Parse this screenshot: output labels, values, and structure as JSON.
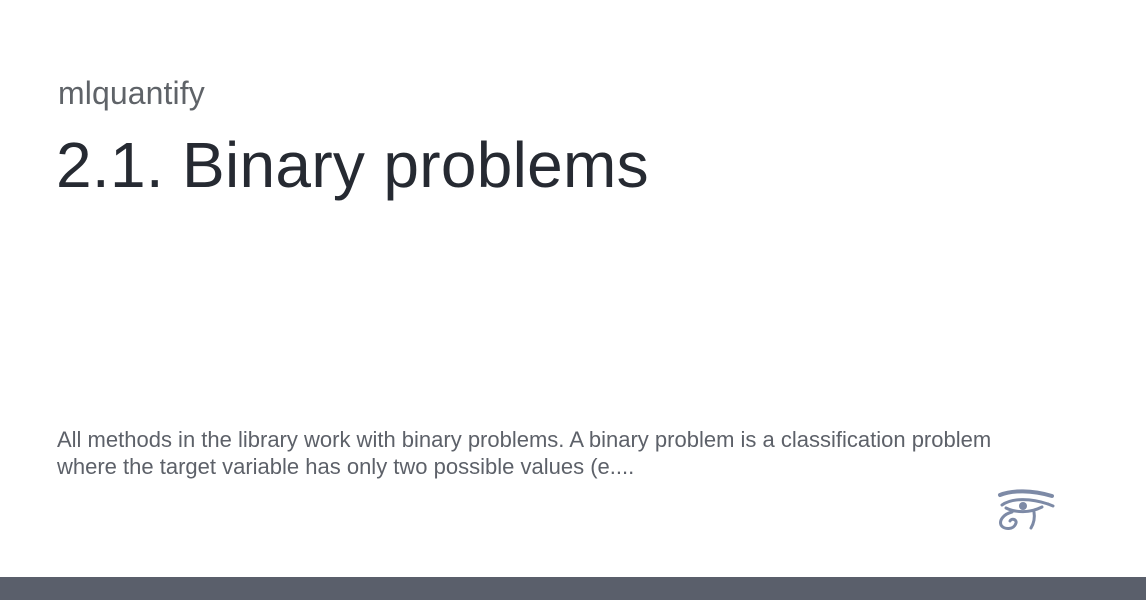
{
  "card": {
    "site_name": "mlquantify",
    "title": "2.1. Binary problems",
    "description": "All methods in the library work with binary problems. A binary problem is a classification problem where the target variable has only two possible values (e...."
  },
  "logo": {
    "icon": "eye-of-horus-icon",
    "color": "#7d8aa6"
  },
  "colors": {
    "background": "#ffffff",
    "site_name": "#5f6368",
    "title": "#262a32",
    "description": "#5d6169",
    "bottom_bar": "#5a5f6b"
  }
}
